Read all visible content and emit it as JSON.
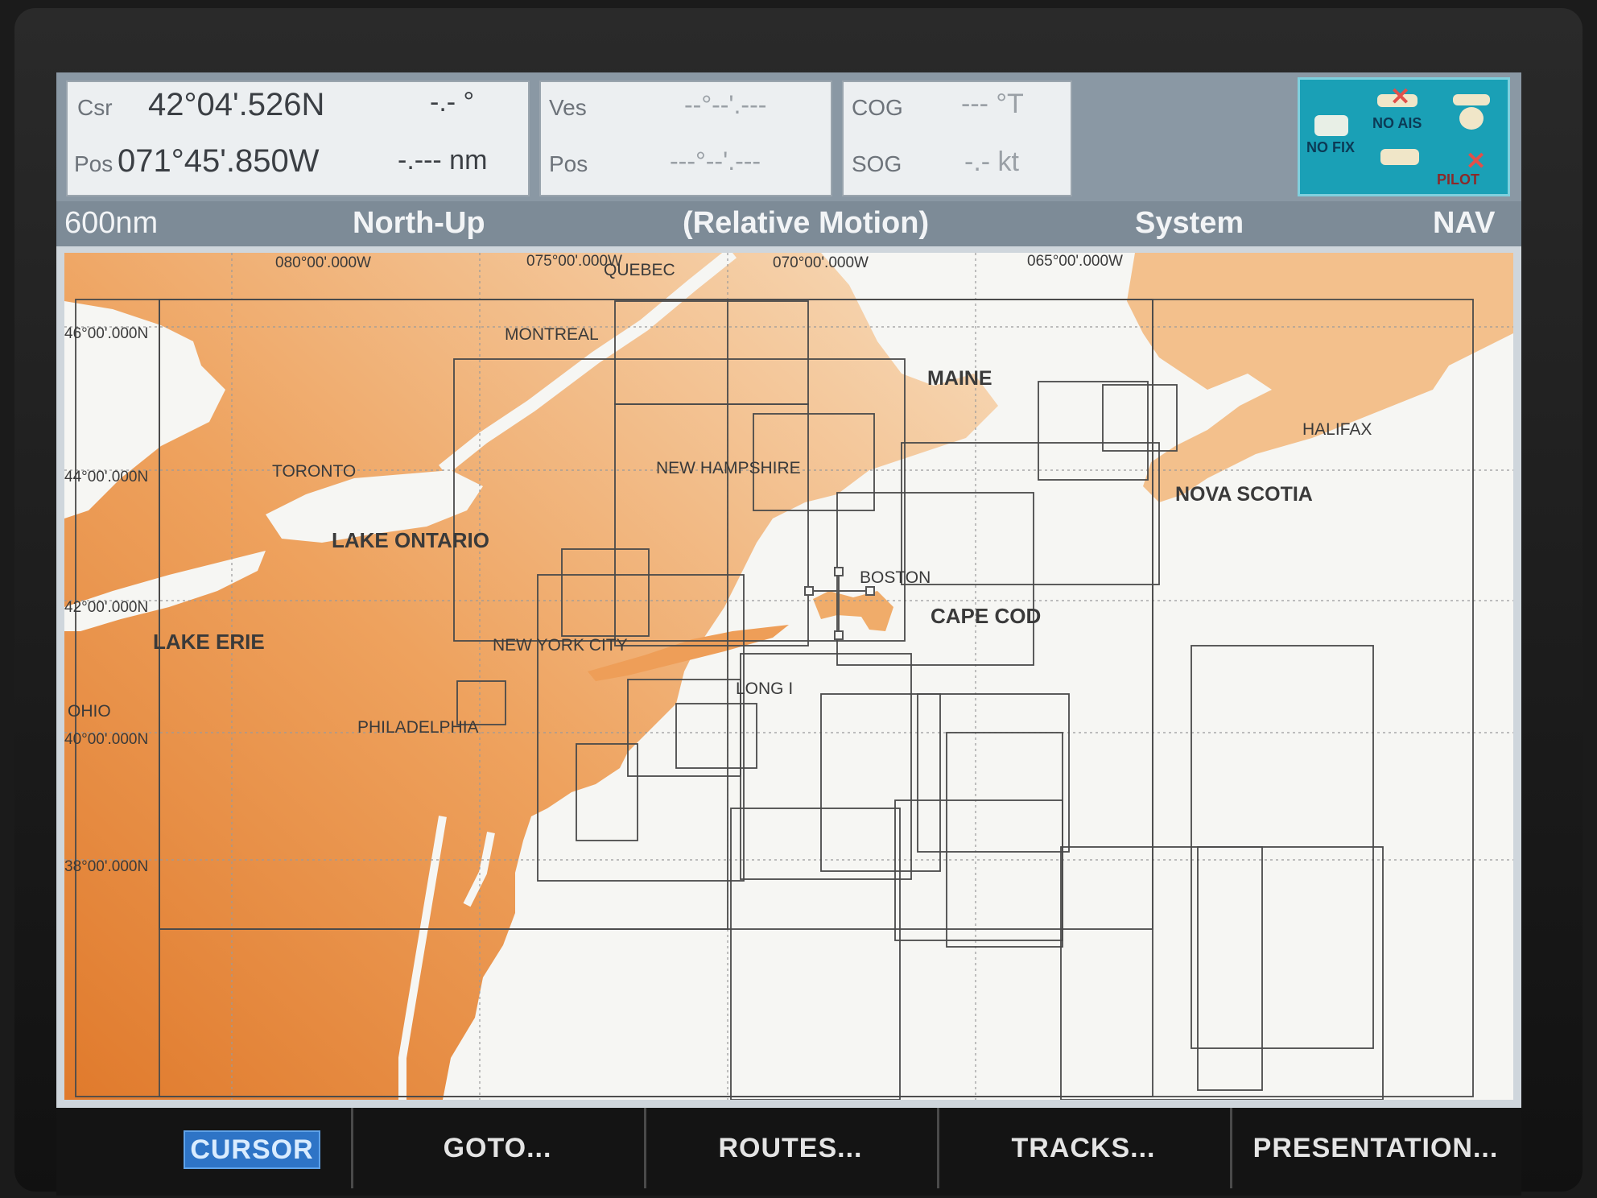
{
  "databar": {
    "cursor_panel": {
      "csr_label": "Csr",
      "csr_lat": "42°04'.526N",
      "csr_bearing": "-.- °",
      "pos_label": "Pos",
      "pos_lon": "071°45'.850W",
      "pos_range": "-.--- nm"
    },
    "vessel_panel": {
      "ves_label": "Ves",
      "ves_value": "--°--'.---",
      "pos_label": "Pos",
      "pos_value": "---°--'.---"
    },
    "course_panel": {
      "cog_label": "COG",
      "cog_value": "--- °T",
      "sog_label": "SOG",
      "sog_value": "-.- kt"
    },
    "status": {
      "no_fix": "NO FIX",
      "no_ais": "NO AIS",
      "pilot": "PILOT"
    }
  },
  "modebar": {
    "range": "600nm",
    "orientation": "North-Up",
    "motion": "(Relative Motion)",
    "datum": "System",
    "mode": "NAV"
  },
  "chart": {
    "lon_labels": [
      "080°00'.000W",
      "075°00'.000W",
      "070°00'.000W",
      "065°00'.000W"
    ],
    "lat_labels": [
      "46°00'.000N",
      "44°00'.000N",
      "42°00'.000N",
      "40°00'.000N",
      "38°00'.000N"
    ],
    "places": {
      "quebec": "QUEBEC",
      "montreal": "MONTREAL",
      "maine": "MAINE",
      "halifax": "HALIFAX",
      "toronto": "TORONTO",
      "new_hampshire": "NEW HAMPSHIRE",
      "nova_scotia": "NOVA SCOTIA",
      "lake_ontario": "LAKE ONTARIO",
      "boston": "BOSTON",
      "cape_cod": "CAPE COD",
      "lake_erie": "LAKE ERIE",
      "new_york_city": "NEW YORK CITY",
      "long_island": "LONG I",
      "ohio": "OHIO",
      "philadelphia": "PHILADELPHIA"
    },
    "colors": {
      "land_dark": "#e98a3e",
      "land_light": "#f6d8b2",
      "water": "#f6f6f3"
    }
  },
  "softkeys": {
    "cursor": "CURSOR",
    "goto": "GOTO...",
    "routes": "ROUTES...",
    "tracks": "TRACKS...",
    "presentation": "PRESENTATION..."
  }
}
